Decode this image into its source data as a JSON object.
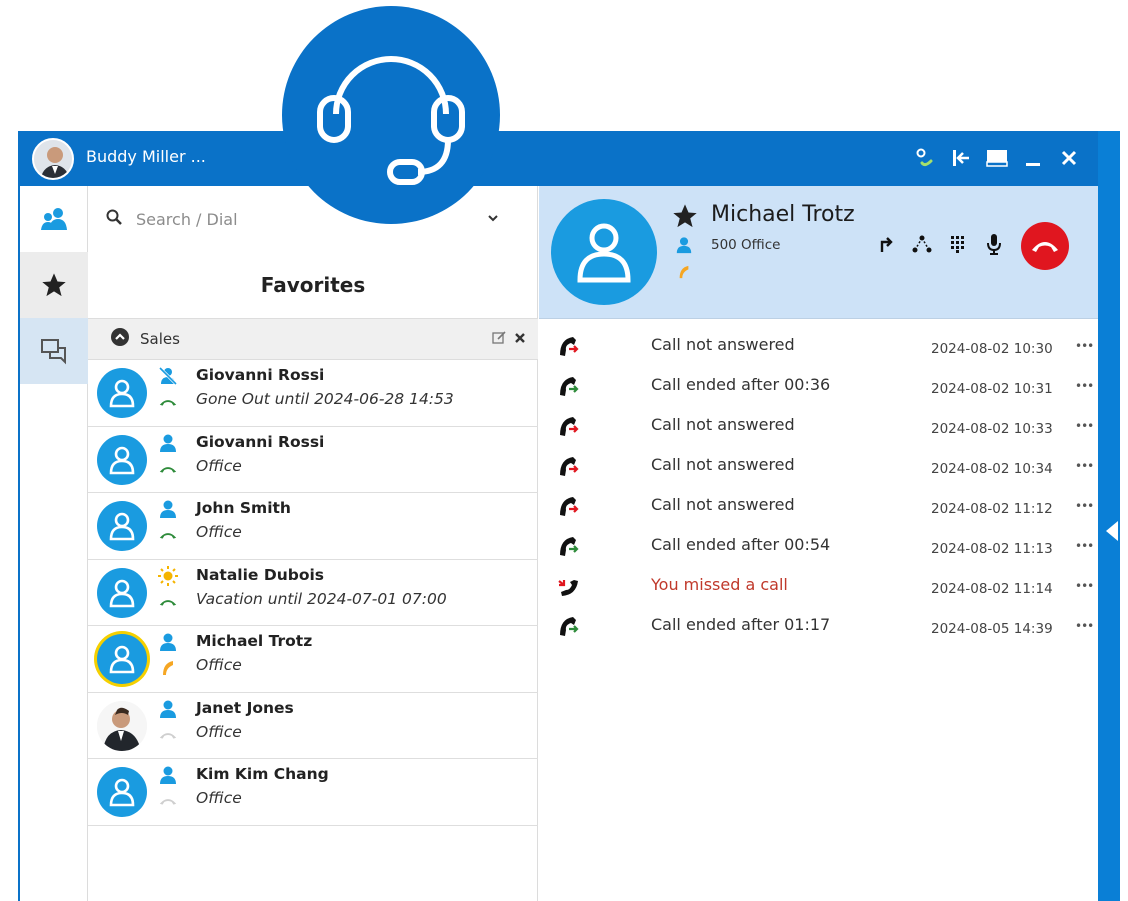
{
  "titlebar": {
    "user_name": "Buddy Miller ..."
  },
  "search": {
    "placeholder": "Search / Dial"
  },
  "favorites": {
    "title": "Favorites"
  },
  "group": {
    "label": "Sales"
  },
  "contacts": [
    {
      "name": "Giovanni Rossi",
      "sub": "Gone Out until 2024-06-28 14:53",
      "status": "away-icon",
      "phone": "idle-green"
    },
    {
      "name": "Giovanni Rossi",
      "sub": "Office",
      "status": "available-icon",
      "phone": "idle-green"
    },
    {
      "name": "John Smith",
      "sub": "Office",
      "status": "available-icon",
      "phone": "idle-green"
    },
    {
      "name": "Natalie Dubois",
      "sub": "Vacation until 2024-07-01 07:00",
      "status": "sun-icon",
      "phone": "idle-green"
    },
    {
      "name": "Michael Trotz",
      "sub": "Office",
      "status": "available-icon",
      "phone": "ringing-orange"
    },
    {
      "name": "Janet Jones",
      "sub": "Office",
      "status": "available-icon",
      "phone": "offline-gray"
    },
    {
      "name": "Kim Kim Chang",
      "sub": "Office",
      "status": "available-icon",
      "phone": "offline-gray"
    }
  ],
  "call": {
    "name": "Michael Trotz",
    "extension": "500  Office"
  },
  "history": [
    {
      "text": "Call not answered",
      "time": "2024-08-02 10:30",
      "more": "•••",
      "type": "outgoing-unanswered"
    },
    {
      "text": "Call ended after 00:36",
      "time": "2024-08-02 10:31",
      "more": "•••",
      "type": "outgoing-ended"
    },
    {
      "text": "Call not answered",
      "time": "2024-08-02 10:33",
      "more": "•••",
      "type": "outgoing-unanswered"
    },
    {
      "text": "Call not answered",
      "time": "2024-08-02 10:34",
      "more": "•••",
      "type": "outgoing-unanswered"
    },
    {
      "text": "Call not answered",
      "time": "2024-08-02 11:12",
      "more": "•••",
      "type": "outgoing-unanswered"
    },
    {
      "text": "Call ended after 00:54",
      "time": "2024-08-02 11:13",
      "more": "•••",
      "type": "outgoing-ended"
    },
    {
      "text": "You missed a call",
      "time": "2024-08-02 11:14",
      "more": "•••",
      "type": "missed"
    },
    {
      "text": "Call ended after 01:17",
      "time": "2024-08-05 14:39",
      "more": "•••",
      "type": "outgoing-ended"
    }
  ],
  "colors": {
    "brand": "#0a72c8",
    "avatar": "#1a9be0",
    "header_bg": "#cde2f7",
    "hangup": "#e0161f",
    "available": "#1a9be0",
    "idle_phone": "#2e8b3a",
    "ringing": "#f5a623",
    "missed_text": "#c0392b"
  }
}
